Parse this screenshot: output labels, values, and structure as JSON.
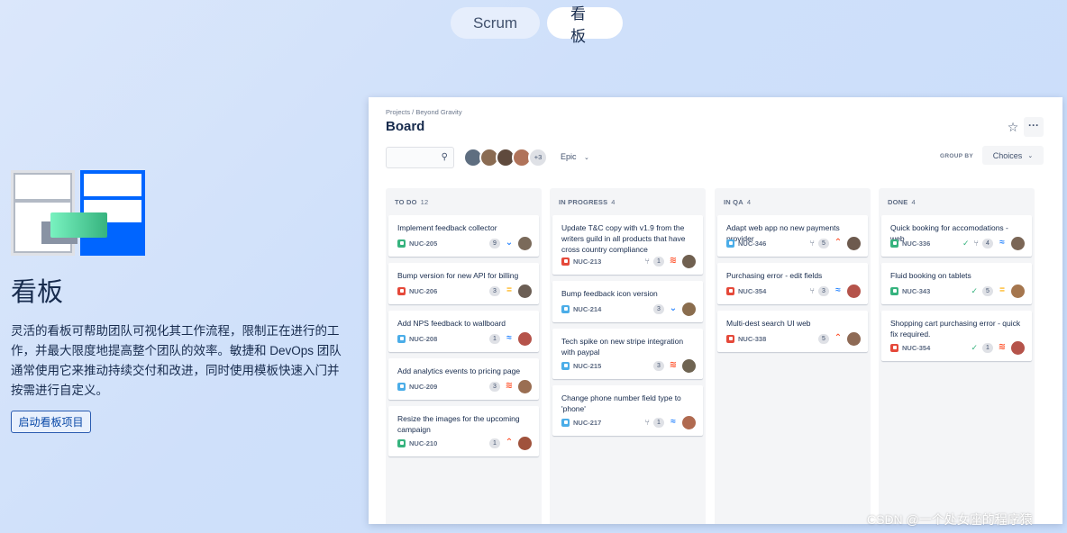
{
  "tabs": [
    {
      "label": "Scrum",
      "active": false
    },
    {
      "label": "看板",
      "active": true
    }
  ],
  "left": {
    "title": "看板",
    "description": "灵活的看板可帮助团队可视化其工作流程，限制正在进行的工作，并最大限度地提高整个团队的效率。敏捷和 DevOps 团队通常使用它来推动持续交付和改进，同时使用模板快速入门并按需进行自定义。",
    "button": "启动看板项目"
  },
  "board": {
    "breadcrumb": "Projects / Beyond Gravity",
    "title": "Board",
    "avatars_more": "+3",
    "epic_label": "Epic",
    "group_by_label": "GROUP BY",
    "group_by_value": "Choices",
    "columns": [
      {
        "name": "TO DO",
        "count": "12",
        "cards": [
          {
            "title": "Implement feedback collector",
            "key": "NUC-205",
            "points": "9",
            "type": "story",
            "priority": "low",
            "avatar": "#7a6a5a"
          },
          {
            "title": "Bump version for new API for billing",
            "key": "NUC-206",
            "points": "3",
            "type": "bug",
            "priority": "med",
            "avatar": "#6b5e54"
          },
          {
            "title": "Add NPS feedback to wallboard",
            "key": "NUC-208",
            "points": "1",
            "type": "task",
            "priority": "lowest",
            "avatar": "#b5534a"
          },
          {
            "title": "Add analytics events to pricing page",
            "key": "NUC-209",
            "points": "3",
            "type": "task",
            "priority": "highest",
            "avatar": "#9a6e52"
          },
          {
            "title": "Resize the images for the upcoming campaign",
            "key": "NUC-210",
            "points": "1",
            "type": "story",
            "priority": "high",
            "avatar": "#a0523c"
          }
        ]
      },
      {
        "name": "IN PROGRESS",
        "count": "4",
        "cards": [
          {
            "title": "Update T&C copy with v1.9 from the writers guild in all products that have cross country compliance",
            "key": "NUC-213",
            "points": "1",
            "type": "bug",
            "priority": "highest",
            "avatar": "#706050",
            "branch": true
          },
          {
            "title": "Bump feedback icon version",
            "key": "NUC-214",
            "points": "3",
            "type": "task",
            "priority": "low",
            "avatar": "#8a6d4e"
          },
          {
            "title": "Tech spike on new stripe integration with paypal",
            "key": "NUC-215",
            "points": "3",
            "type": "task",
            "priority": "highest",
            "avatar": "#6f6452"
          },
          {
            "title": "Change phone number field type to 'phone'",
            "key": "NUC-217",
            "points": "1",
            "type": "task",
            "priority": "lowest",
            "avatar": "#b06a50",
            "branch": true
          }
        ]
      },
      {
        "name": "IN QA",
        "count": "4",
        "cards": [
          {
            "title": "Adapt web app no new payments provider",
            "key": "NUC-346",
            "points": "5",
            "type": "task",
            "priority": "high",
            "avatar": "#6d5a4e",
            "branch": true
          },
          {
            "title": "Purchasing error - edit fields",
            "key": "NUC-354",
            "points": "3",
            "type": "bug",
            "priority": "lowest",
            "avatar": "#b5534a",
            "branch": true
          },
          {
            "title": "Multi-dest search UI web",
            "key": "NUC-338",
            "points": "5",
            "type": "bug",
            "priority": "high",
            "avatar": "#8e6a55"
          }
        ]
      },
      {
        "name": "DONE",
        "count": "4",
        "cards": [
          {
            "title": "Quick booking for accomodations - web",
            "key": "NUC-336",
            "points": "4",
            "type": "story",
            "priority": "lowest",
            "avatar": "#7b6656",
            "branch": true,
            "done": true
          },
          {
            "title": "Fluid booking on tablets",
            "key": "NUC-343",
            "points": "5",
            "type": "story",
            "priority": "med",
            "avatar": "#a5764e",
            "done": true
          },
          {
            "title": "Shopping cart purchasing error - quick fix required.",
            "key": "NUC-354",
            "points": "1",
            "type": "bug",
            "priority": "highest",
            "avatar": "#b5534a",
            "done": true
          }
        ]
      }
    ]
  },
  "watermark": "CSDN @一个处女座的程序猿",
  "colors": {
    "accent": "#0065ff",
    "background": "#d3e3fb"
  }
}
